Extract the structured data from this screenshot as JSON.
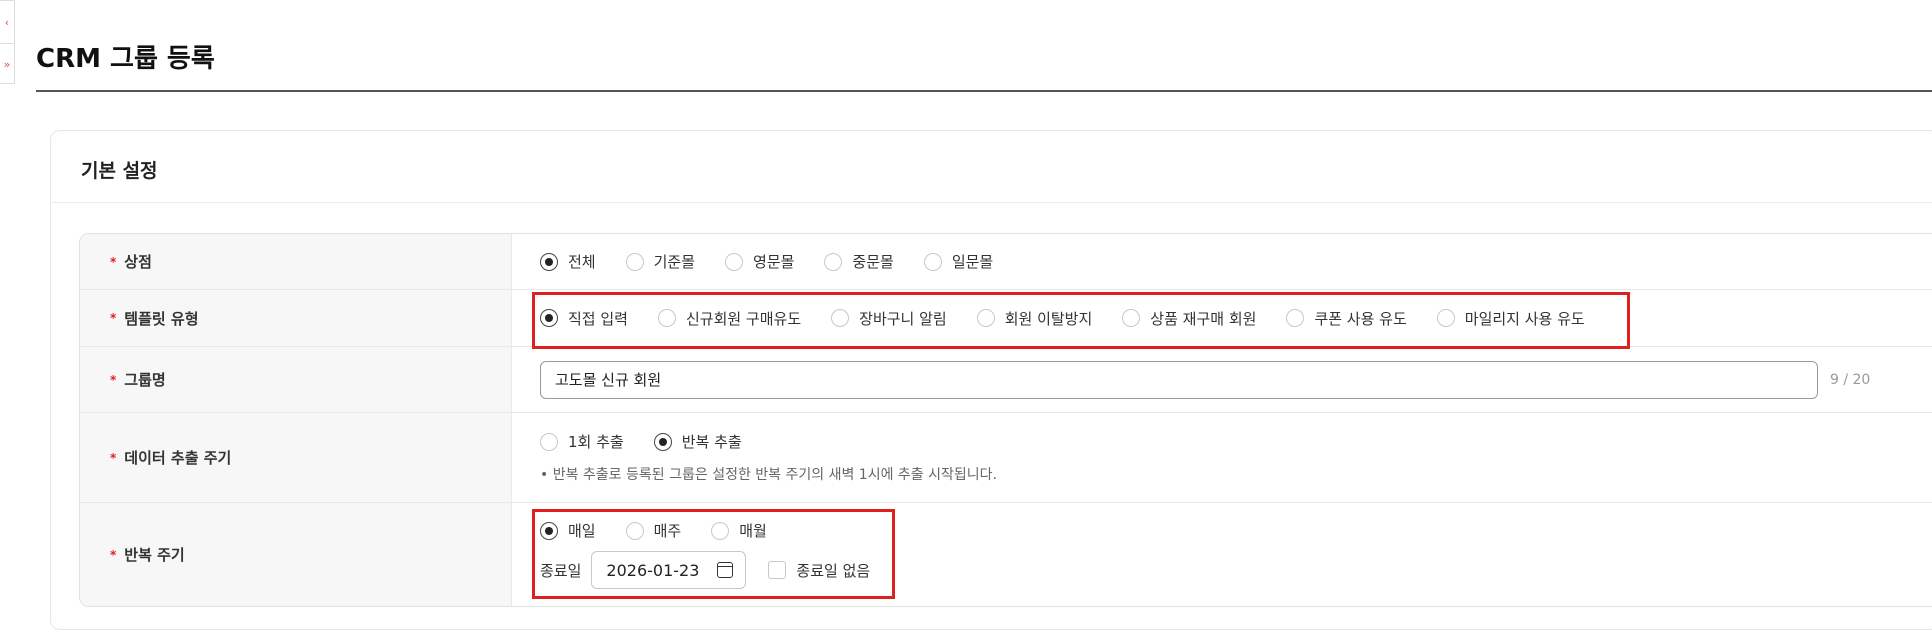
{
  "page": {
    "title": "CRM 그룹 등록"
  },
  "side": {
    "collapse_icon": "‹",
    "up_icon": "»"
  },
  "card": {
    "title": "기본 설정"
  },
  "form": {
    "store": {
      "label": "상점",
      "options": [
        "전체",
        "기준몰",
        "영문몰",
        "중문몰",
        "일문몰"
      ],
      "selected": "전체"
    },
    "template": {
      "label": "템플릿 유형",
      "options": [
        "직접 입력",
        "신규회원 구매유도",
        "장바구니 알림",
        "회원 이탈방지",
        "상품 재구매 회원",
        "쿠폰 사용 유도",
        "마일리지 사용 유도"
      ],
      "selected": "직접 입력"
    },
    "group_name": {
      "label": "그룹명",
      "value": "고도몰 신규 회원",
      "counter": "9 / 20"
    },
    "extract_cycle": {
      "label": "데이터 추출 주기",
      "options": [
        "1회 추출",
        "반복 추출"
      ],
      "selected": "반복 추출",
      "hint": "• 반복 추출로 등록된 그룹은 설정한 반복 주기의 새벽 1시에 추출 시작됩니다."
    },
    "repeat_cycle": {
      "label": "반복 주기",
      "options": [
        "매일",
        "매주",
        "매월"
      ],
      "selected": "매일",
      "end_date_label": "종료일",
      "end_date": "2026-01-23",
      "no_end_label": "종료일 없음",
      "no_end_checked": false
    }
  },
  "required_mark": "*"
}
